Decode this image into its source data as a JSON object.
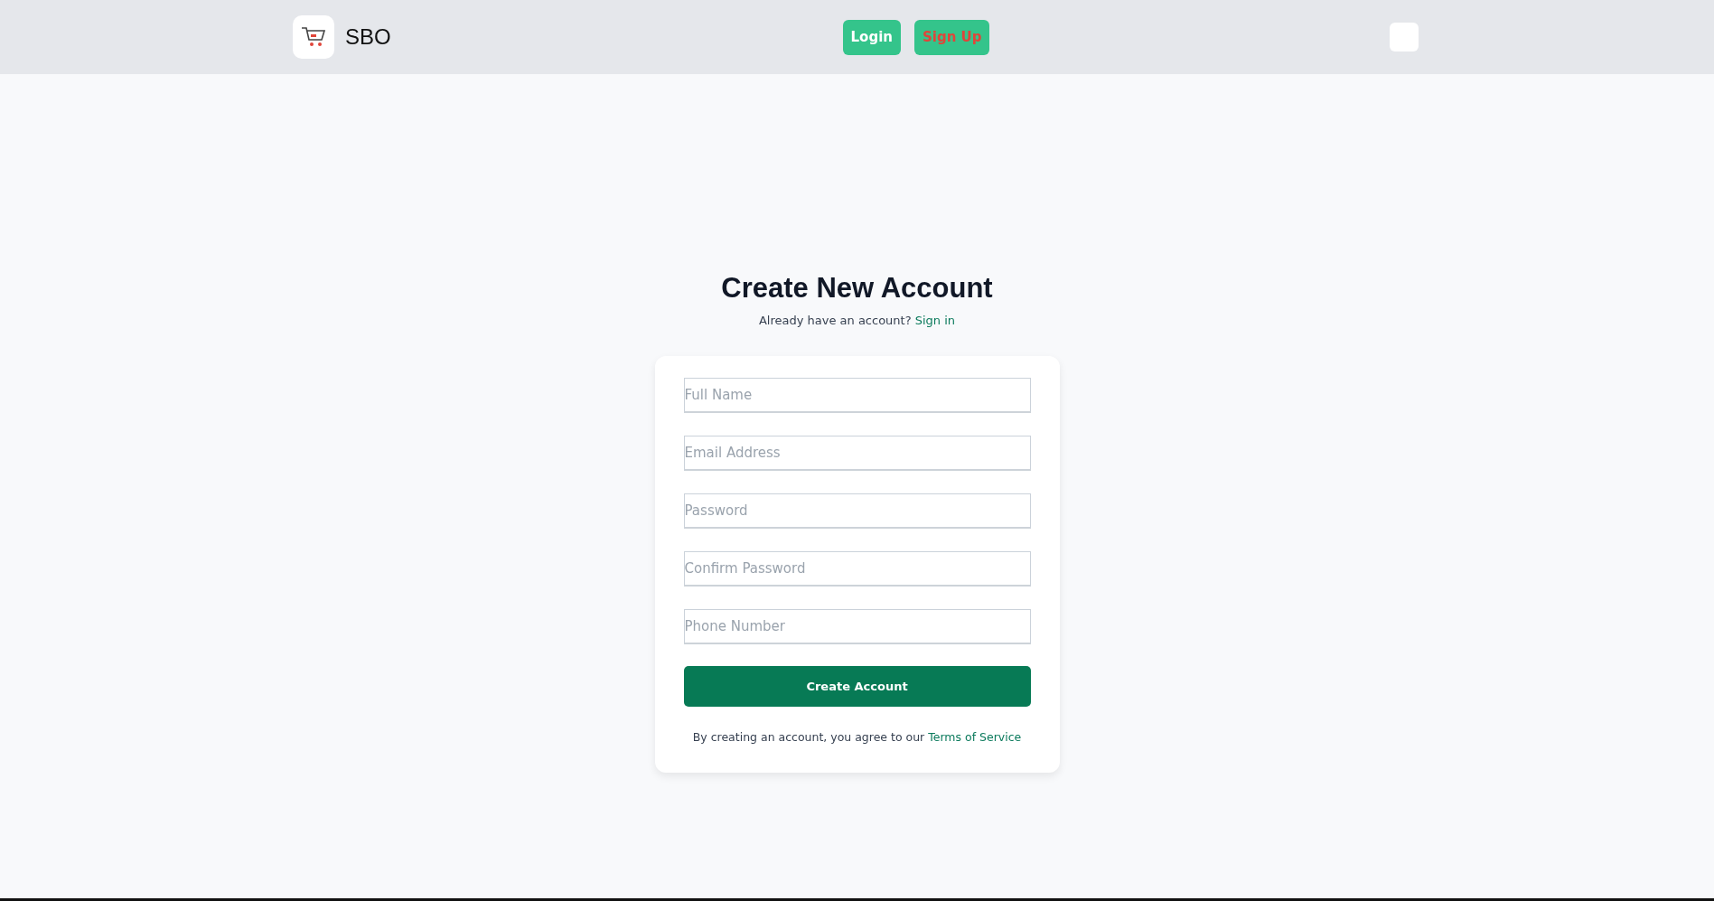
{
  "header": {
    "brand": "SBO",
    "buttons": [
      {
        "label": "Login",
        "kind": "login"
      },
      {
        "label": "Sign Up",
        "kind": "signup"
      }
    ]
  },
  "heading": {
    "title": "Create New Account",
    "prompt": "Already have an account?",
    "link": "Sign in"
  },
  "form": {
    "fields": [
      {
        "placeholder": "Full Name"
      },
      {
        "placeholder": "Email Address"
      },
      {
        "placeholder": "Password"
      },
      {
        "placeholder": "Confirm Password"
      },
      {
        "placeholder": "Phone Number"
      }
    ],
    "submit": "Create Account",
    "terms": "By creating an account, you agree to our",
    "terms_link": "Terms of Service"
  }
}
